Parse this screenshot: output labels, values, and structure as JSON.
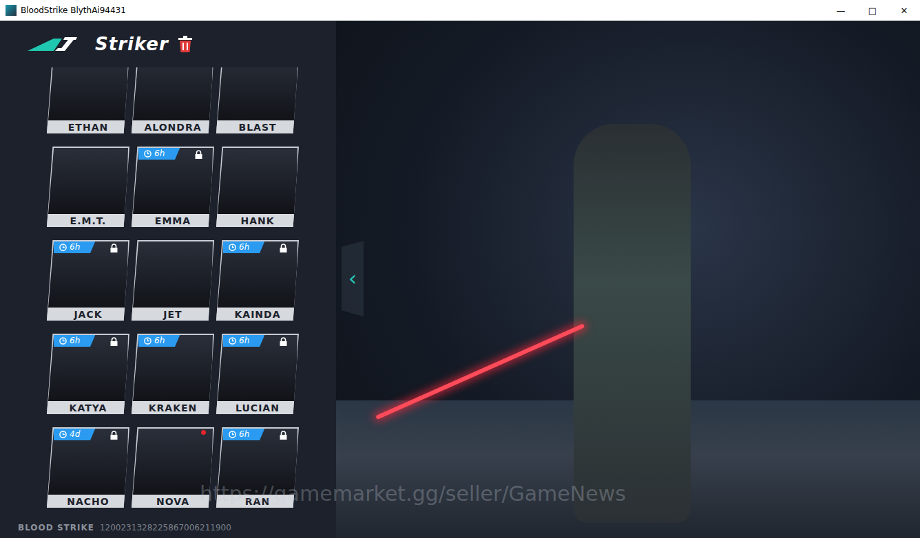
{
  "window": {
    "title": "BloodStrike BlythAi94431",
    "controls": [
      "—",
      "□",
      "✕"
    ]
  },
  "header": {
    "title": "Striker"
  },
  "characters": [
    {
      "name": "ETHAN",
      "badge": "",
      "locked": false,
      "new": false
    },
    {
      "name": "ALONDRA",
      "badge": "",
      "locked": true,
      "new": false
    },
    {
      "name": "BLAST",
      "badge": "",
      "locked": true,
      "new": false
    },
    {
      "name": "E.M.T.",
      "badge": "",
      "locked": false,
      "new": false
    },
    {
      "name": "EMMA",
      "badge": "6h",
      "locked": true,
      "new": false
    },
    {
      "name": "HANK",
      "badge": "",
      "locked": false,
      "new": false
    },
    {
      "name": "JACK",
      "badge": "6h",
      "locked": true,
      "new": false
    },
    {
      "name": "JET",
      "badge": "",
      "locked": false,
      "new": false
    },
    {
      "name": "KAINDA",
      "badge": "6h",
      "locked": true,
      "new": false
    },
    {
      "name": "KATYA",
      "badge": "6h",
      "locked": true,
      "new": false
    },
    {
      "name": "KRAKEN",
      "badge": "6h",
      "locked": false,
      "new": false
    },
    {
      "name": "LUCIAN",
      "badge": "6h",
      "locked": true,
      "new": false
    },
    {
      "name": "NACHO",
      "badge": "4d",
      "locked": true,
      "new": false
    },
    {
      "name": "NOVA",
      "badge": "",
      "locked": false,
      "new": true
    },
    {
      "name": "RAN",
      "badge": "6h",
      "locked": true,
      "new": false
    }
  ],
  "scene": {
    "arrow": "‹"
  },
  "footer": {
    "brand": "BLOOD STRIKE",
    "id": "1200231328225867006211900"
  },
  "watermark": "https://gamemarket.gg/seller/GameNews"
}
